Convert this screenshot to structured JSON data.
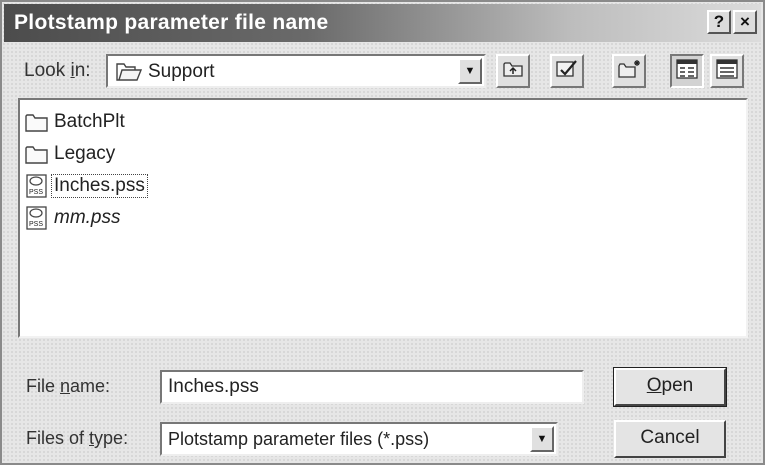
{
  "window": {
    "title": "Plotstamp parameter file name",
    "help_label": "?",
    "close_label": "×"
  },
  "look_in": {
    "label_prefix": "Look ",
    "label_accel": "i",
    "label_suffix": "n:",
    "value": "Support",
    "icon": "folder-icon"
  },
  "toolbar": {
    "buttons": [
      {
        "name": "up-one-level-button",
        "icon": "up-folder-icon"
      },
      {
        "name": "search-web-button",
        "icon": "search-web-icon"
      },
      {
        "name": "new-folder-button",
        "icon": "new-folder-icon"
      },
      {
        "name": "list-view-button",
        "icon": "list-view-icon",
        "pressed": true
      },
      {
        "name": "details-view-button",
        "icon": "details-view-icon",
        "pressed": false
      }
    ]
  },
  "files": [
    {
      "name": "BatchPlt",
      "type": "folder",
      "icon": "folder-icon"
    },
    {
      "name": "Legacy",
      "type": "folder",
      "icon": "folder-icon"
    },
    {
      "name": "Inches.pss",
      "type": "file",
      "icon": "pss-file-icon",
      "selected": true
    },
    {
      "name": "mm.pss",
      "type": "file",
      "icon": "pss-file-icon",
      "italic": true
    }
  ],
  "file_name": {
    "label_prefix": "File ",
    "label_accel": "n",
    "label_suffix": "ame:",
    "value": "Inches.pss"
  },
  "file_type": {
    "label_prefix": "Files of ",
    "label_accel": "t",
    "label_suffix": "ype:",
    "value": "Plotstamp parameter files (*.pss)"
  },
  "buttons": {
    "open_accel": "O",
    "open_rest": "pen",
    "cancel": "Cancel"
  }
}
